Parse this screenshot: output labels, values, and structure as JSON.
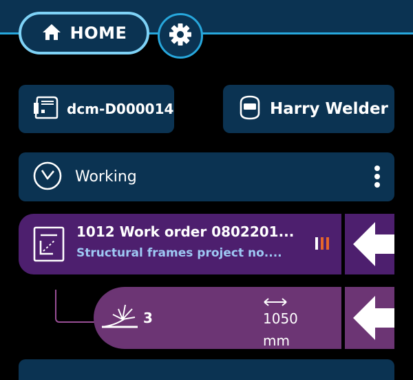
{
  "nav": {
    "home_label": "HOME",
    "home_icon": "home-icon",
    "settings_icon": "gear-icon"
  },
  "station": {
    "icon": "welding-machine-icon",
    "label": "dcm-D000014"
  },
  "operator": {
    "icon": "welder-helmet-icon",
    "label": "Harry Welder"
  },
  "status": {
    "icon": "clock-icon",
    "label": "Working",
    "menu_icon": "more-vertical-icon"
  },
  "work_order": {
    "icon": "document-icon",
    "title": "1012 Work order 0802201...",
    "subtitle": "Structural frames project no....",
    "indicator_icon": "signal-bars-icon",
    "action_icon": "arrow-left-icon"
  },
  "weld_item": {
    "icon": "weld-spark-icon",
    "count": "3",
    "dimension_icon": "length-arrows-icon",
    "length": "1050",
    "unit": "mm",
    "action_icon": "arrow-left-icon"
  },
  "colors": {
    "background": "#000000",
    "primary_card": "#0b3352",
    "accent": "#27a7dc",
    "work_order": "#4d1f6e",
    "weld_item": "#6c3574",
    "indicator": "#e8662a"
  }
}
